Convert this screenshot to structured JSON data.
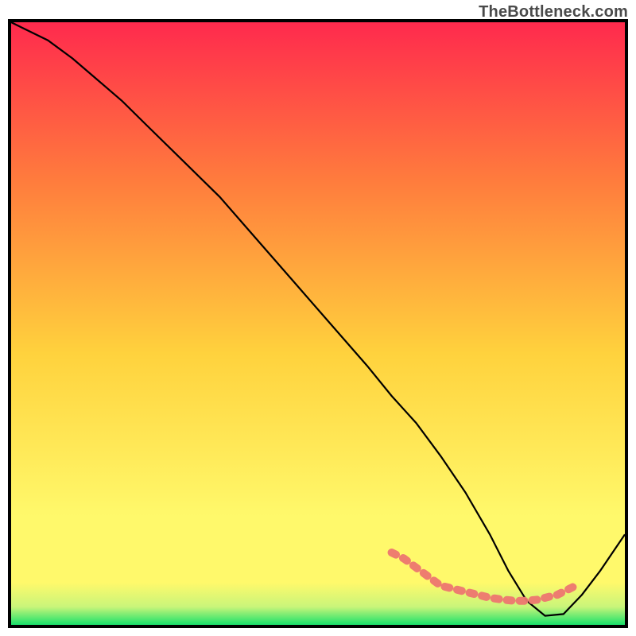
{
  "watermark": "TheBottleneck.com",
  "chart_data": {
    "type": "line",
    "title": "",
    "xlabel": "",
    "ylabel": "",
    "xlim": [
      0,
      100
    ],
    "ylim": [
      0,
      100
    ],
    "series": [
      {
        "name": "bottleneck-curve",
        "x": [
          0,
          2,
          6,
          10,
          14,
          18,
          22,
          28,
          34,
          40,
          46,
          52,
          58,
          62,
          66,
          70,
          74,
          78,
          81,
          84,
          87,
          90,
          93,
          96,
          100
        ],
        "values": [
          100,
          99,
          97,
          94,
          90.5,
          87,
          83,
          77,
          71,
          64,
          57,
          50,
          43,
          38,
          33.5,
          28,
          22,
          15,
          9,
          4,
          1.5,
          1.8,
          5,
          9,
          15
        ]
      },
      {
        "name": "fit-band",
        "x": [
          62,
          64,
          66,
          68,
          70,
          72,
          74,
          76,
          78,
          80,
          82,
          84,
          86,
          87,
          89,
          90,
          91,
          92
        ],
        "values": [
          12,
          11,
          9.5,
          8,
          6.5,
          6,
          5.5,
          5,
          4.5,
          4.2,
          4,
          4,
          4.2,
          4.5,
          5,
          5.5,
          6,
          6.5
        ]
      }
    ],
    "gradient_colors": {
      "top": "#ff2a4d",
      "mid1": "#ff7b3d",
      "mid2": "#ffd23d",
      "mid3": "#fff96b",
      "bottom": "#18e06b"
    },
    "curve_color": "#000000",
    "band_color": "#ed7670",
    "frame_color": "#000000"
  }
}
